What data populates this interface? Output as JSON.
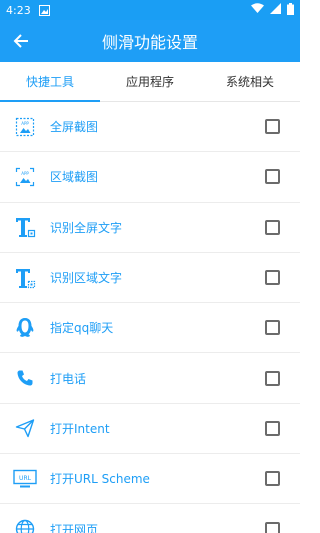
{
  "status": {
    "time": "4:23"
  },
  "appbar": {
    "title": "侧滑功能设置"
  },
  "tabs": [
    {
      "label": "快捷工具",
      "active": true
    },
    {
      "label": "应用程序",
      "active": false
    },
    {
      "label": "系统相关",
      "active": false
    }
  ],
  "items": [
    {
      "label": "全屏截图",
      "icon": "fullscreen-screenshot-icon",
      "checked": false
    },
    {
      "label": "区域截图",
      "icon": "area-screenshot-icon",
      "checked": false
    },
    {
      "label": "识别全屏文字",
      "icon": "text-recognition-icon",
      "checked": false
    },
    {
      "label": "识别区域文字",
      "icon": "text-recognition-icon",
      "checked": false
    },
    {
      "label": "指定qq聊天",
      "icon": "qq-icon",
      "checked": false
    },
    {
      "label": "打电话",
      "icon": "phone-icon",
      "checked": false
    },
    {
      "label": "打开Intent",
      "icon": "send-icon",
      "checked": false
    },
    {
      "label": "打开URL Scheme",
      "icon": "url-icon",
      "checked": false
    },
    {
      "label": "打开网页",
      "icon": "globe-icon",
      "checked": false
    }
  ],
  "colors": {
    "primary": "#1e9ef6",
    "checkbox_border": "#6b6b6b"
  }
}
